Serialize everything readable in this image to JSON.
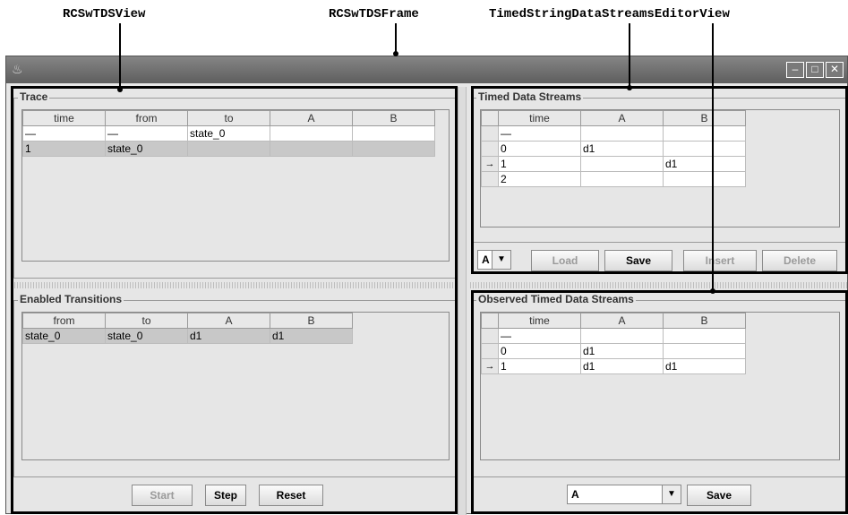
{
  "annotations": {
    "left": "RCSwTDSView",
    "middle": "RCSwTDSFrame",
    "right": "TimedStringDataStreamsEditorView"
  },
  "window": {
    "java_icon": "java-cup-icon",
    "minimize_glyph": "‒",
    "maximize_glyph": "□",
    "close_glyph": "✕"
  },
  "trace": {
    "title": "Trace",
    "columns": [
      "time",
      "from",
      "to",
      "A",
      "B"
    ],
    "rows": [
      [
        "—",
        "—",
        "state_0",
        "",
        ""
      ],
      [
        "1",
        "state_0",
        "",
        "",
        ""
      ]
    ]
  },
  "enabled_transitions": {
    "title": "Enabled Transitions",
    "columns": [
      "from",
      "to",
      "A",
      "B"
    ],
    "rows": [
      [
        "state_0",
        "state_0",
        "d1",
        "d1"
      ]
    ]
  },
  "controls": {
    "start": "Start",
    "step": "Step",
    "reset": "Reset"
  },
  "timed_data_streams": {
    "title": "Timed Data Streams",
    "columns": [
      "time",
      "A",
      "B"
    ],
    "rows": [
      {
        "marker": "",
        "cells": [
          "—",
          "",
          ""
        ]
      },
      {
        "marker": "",
        "cells": [
          "0",
          "d1",
          ""
        ]
      },
      {
        "marker": "→",
        "cells": [
          "1",
          "",
          "d1"
        ]
      },
      {
        "marker": "",
        "cells": [
          "2",
          "",
          ""
        ]
      }
    ],
    "stream_select": "A",
    "load": "Load",
    "save": "Save",
    "insert": "Insert",
    "delete": "Delete"
  },
  "observed_streams": {
    "title": "Observed Timed Data Streams",
    "columns": [
      "time",
      "A",
      "B"
    ],
    "rows": [
      {
        "marker": "",
        "cells": [
          "—",
          "",
          ""
        ]
      },
      {
        "marker": "",
        "cells": [
          "0",
          "d1",
          ""
        ]
      },
      {
        "marker": "→",
        "cells": [
          "1",
          "d1",
          "d1"
        ]
      }
    ],
    "stream_select": "A",
    "save": "Save"
  }
}
